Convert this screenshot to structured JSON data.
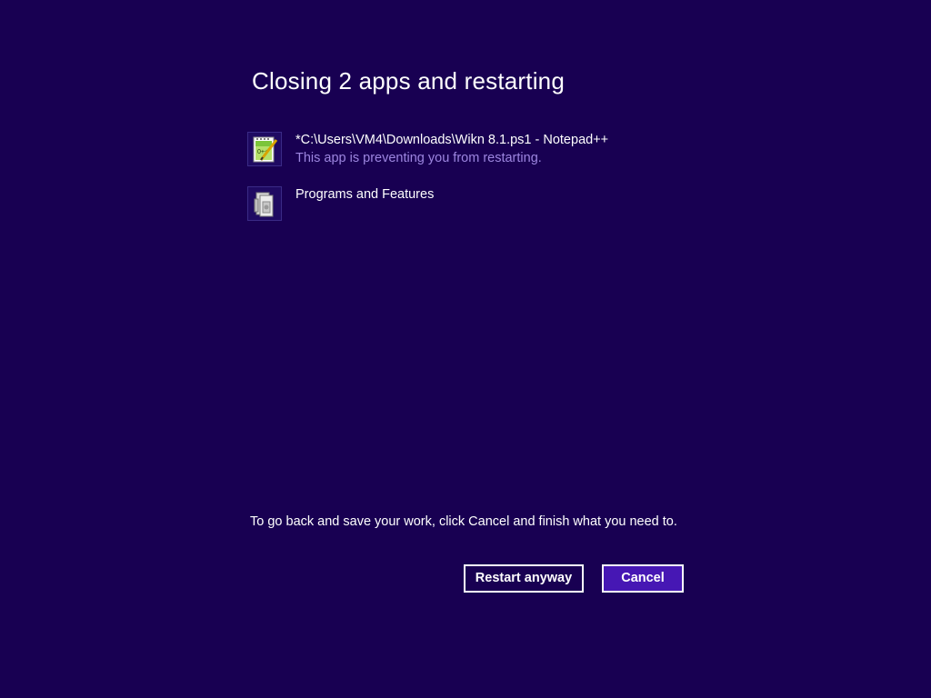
{
  "dialog": {
    "title": "Closing 2 apps and restarting",
    "hint": "To go back and save your work, click Cancel and finish what you need to."
  },
  "apps": [
    {
      "name": "*C:\\Users\\VM4\\Downloads\\Wikn 8.1.ps1 - Notepad++",
      "status": "This app is preventing you from restarting.",
      "icon": "notepad-plus-plus-icon"
    },
    {
      "name": "Programs and Features",
      "status": "",
      "icon": "programs-and-features-icon"
    }
  ],
  "buttons": {
    "restart_label": "Restart anyway",
    "cancel_label": "Cancel"
  },
  "colors": {
    "background": "#180052",
    "accent_button": "#4617b4",
    "status_text": "#9d86e0"
  }
}
